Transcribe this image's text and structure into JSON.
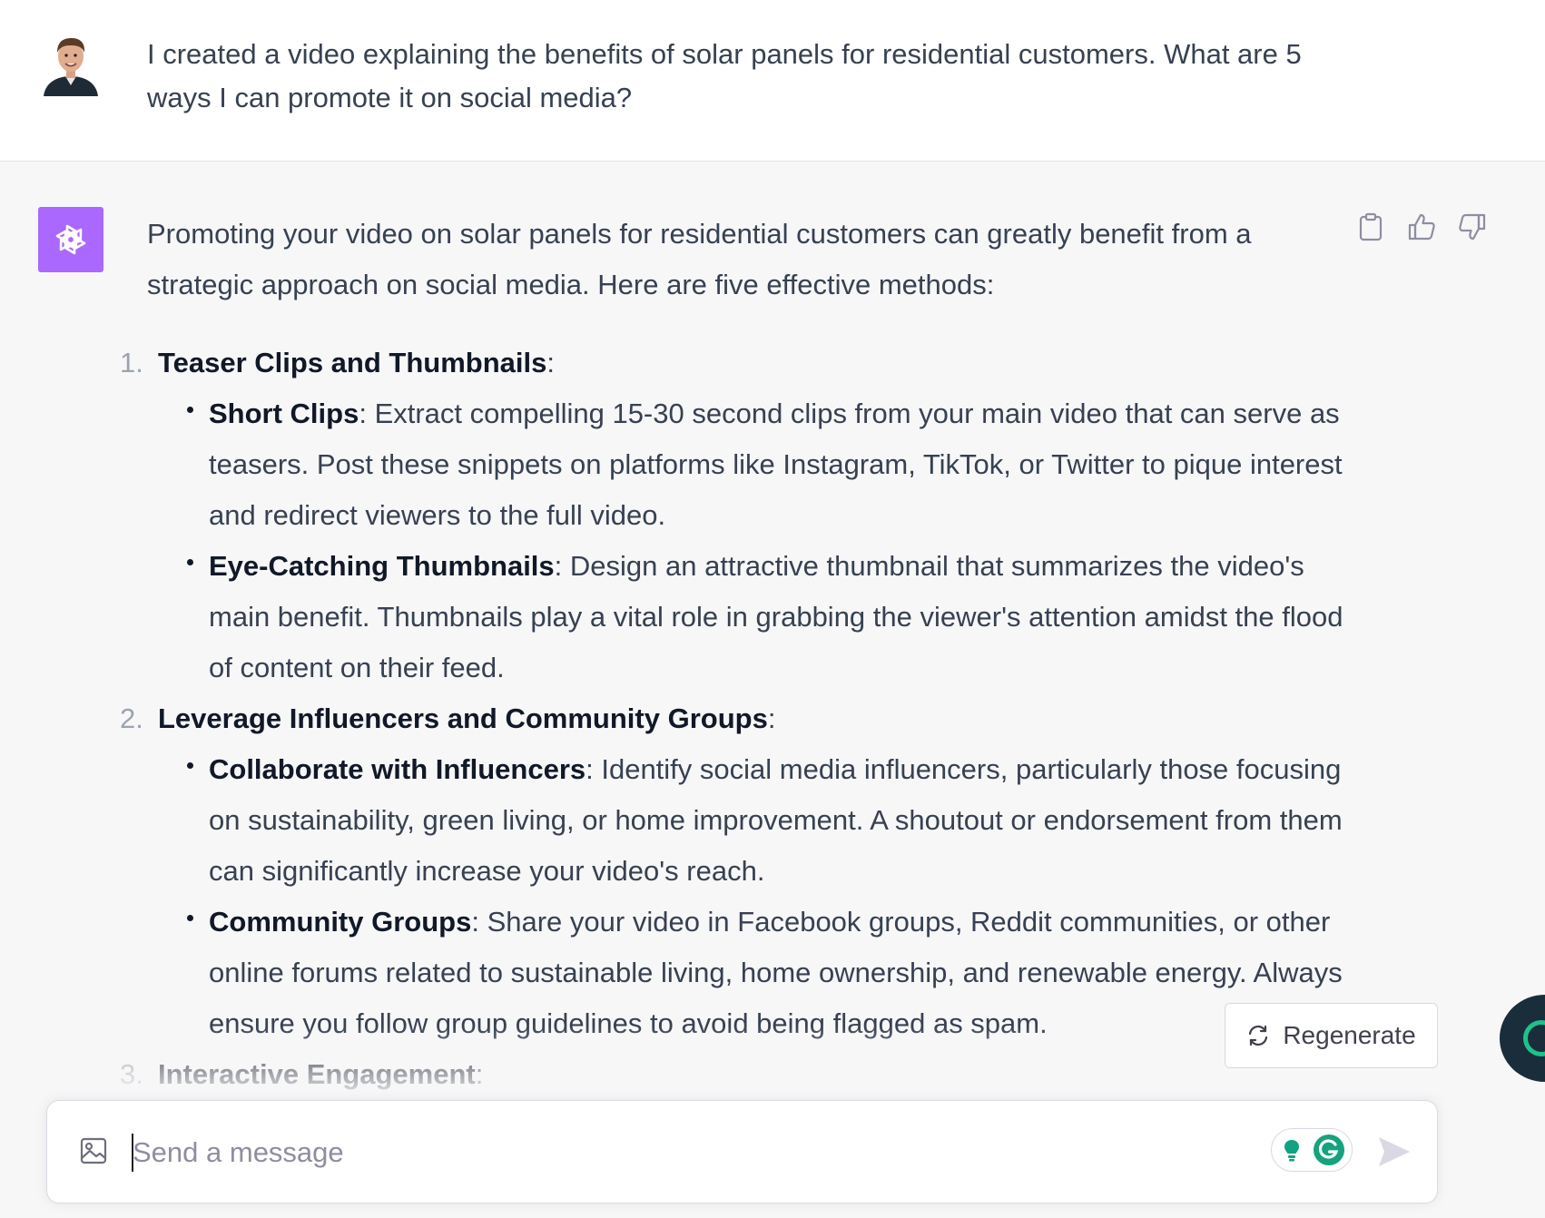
{
  "user_message": {
    "text": "I created a video explaining the benefits of solar panels for residential customers. What are 5 ways I can promote it on social media?"
  },
  "assistant_message": {
    "intro": "Promoting your video on solar panels for residential customers can greatly benefit from a strategic approach on social media. Here are five effective methods:",
    "sections": [
      {
        "number": "1.",
        "heading": "Teaser Clips and Thumbnails",
        "suffix": ":",
        "bullets": [
          {
            "title": "Short Clips",
            "text": ": Extract compelling 15-30 second clips from your main video that can serve as teasers. Post these snippets on platforms like Instagram, TikTok, or Twitter to pique interest and redirect viewers to the full video."
          },
          {
            "title": "Eye-Catching Thumbnails",
            "text": ": Design an attractive thumbnail that summarizes the video's main benefit. Thumbnails play a vital role in grabbing the viewer's attention amidst the flood of content on their feed."
          }
        ]
      },
      {
        "number": "2.",
        "heading": "Leverage Influencers and Community Groups",
        "suffix": ":",
        "bullets": [
          {
            "title": "Collaborate with Influencers",
            "text": ": Identify social media influencers, particularly those focusing on sustainability, green living, or home improvement. A shoutout or endorsement from them can significantly increase your video's reach."
          },
          {
            "title": "Community Groups",
            "text": ": Share your video in Facebook groups, Reddit communities, or other online forums related to sustainable living, home ownership, and renewable energy. Always ensure you follow group guidelines to avoid being flagged as spam."
          }
        ]
      },
      {
        "number": "3.",
        "heading": "Interactive Engagement",
        "suffix": ":",
        "bullets": []
      }
    ]
  },
  "actions": {
    "regenerate_label": "Regenerate"
  },
  "composer": {
    "placeholder": "Send a message",
    "value": ""
  },
  "colors": {
    "assistant_avatar_bg": "#ab68ff",
    "extension_green": "#10a37f",
    "page_bg": "#f7f7f8"
  },
  "icons": [
    "user-avatar",
    "chatgpt-logo-icon",
    "clipboard-icon",
    "thumbs-up-icon",
    "thumbs-down-icon",
    "refresh-icon",
    "image-icon",
    "lightbulb-extension-icon",
    "grammarly-icon",
    "send-icon"
  ]
}
